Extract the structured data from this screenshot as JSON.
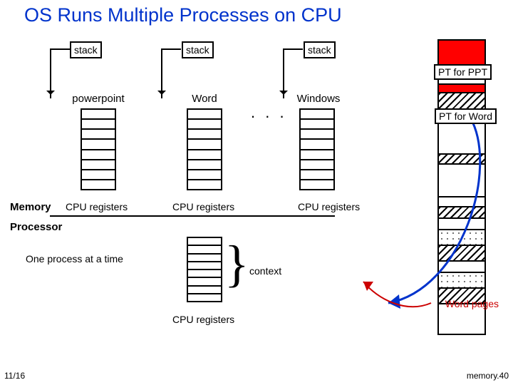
{
  "title": "OS Runs Multiple Processes on CPU",
  "stack_label": "stack",
  "processes": [
    "powerpoint",
    "Word",
    "Windows"
  ],
  "cpu_registers_label": "CPU registers",
  "memory_label": "Memory",
  "processor_label": "Processor",
  "one_process_text": "One process at a time",
  "context_label": "context",
  "pt_ppt": "PT for PPT",
  "pt_word": "PT for Word",
  "word_pages": "Word pages",
  "ellipsis": ". . .",
  "footer": {
    "page": "11/16",
    "slide": "memory.40"
  }
}
